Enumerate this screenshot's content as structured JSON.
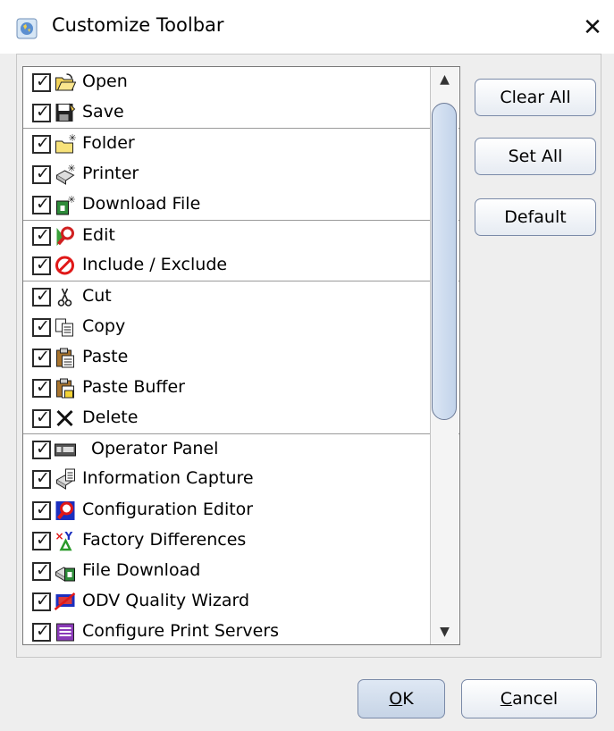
{
  "window": {
    "title": "Customize Toolbar",
    "close_glyph": "✕",
    "app_icon": "app-globe-icon"
  },
  "toolbar_items": [
    {
      "label": "Open",
      "icon": "open-folder-icon",
      "checked": true,
      "group_start": false
    },
    {
      "label": "Save",
      "icon": "save-disk-icon",
      "checked": true,
      "group_start": false
    },
    {
      "label": "Folder",
      "icon": "new-folder-icon",
      "checked": true,
      "group_start": true
    },
    {
      "label": "Printer",
      "icon": "new-printer-icon",
      "checked": true,
      "group_start": false
    },
    {
      "label": "Download File",
      "icon": "download-file-icon",
      "checked": true,
      "group_start": false
    },
    {
      "label": "Edit",
      "icon": "edit-magnifier-icon",
      "checked": true,
      "group_start": true
    },
    {
      "label": "Include / Exclude",
      "icon": "prohibited-icon",
      "checked": true,
      "group_start": false
    },
    {
      "label": "Cut",
      "icon": "scissors-icon",
      "checked": true,
      "group_start": true
    },
    {
      "label": "Copy",
      "icon": "copy-icon",
      "checked": true,
      "group_start": false
    },
    {
      "label": "Paste",
      "icon": "paste-icon",
      "checked": true,
      "group_start": false
    },
    {
      "label": "Paste Buffer",
      "icon": "paste-buffer-icon",
      "checked": true,
      "group_start": false
    },
    {
      "label": "Delete",
      "icon": "delete-x-icon",
      "checked": true,
      "group_start": false
    },
    {
      "label": "Operator Panel",
      "icon": "operator-panel-icon",
      "checked": true,
      "group_start": true
    },
    {
      "label": "Information Capture",
      "icon": "information-capture-icon",
      "checked": true,
      "group_start": false
    },
    {
      "label": "Configuration Editor",
      "icon": "configuration-editor-icon",
      "checked": true,
      "group_start": false
    },
    {
      "label": "Factory Differences",
      "icon": "factory-differences-icon",
      "checked": true,
      "group_start": false
    },
    {
      "label": "File Download",
      "icon": "file-download-icon",
      "checked": true,
      "group_start": false
    },
    {
      "label": "ODV Quality Wizard",
      "icon": "odv-quality-wizard-icon",
      "checked": true,
      "group_start": false
    },
    {
      "label": "Configure Print Servers",
      "icon": "configure-print-servers-icon",
      "checked": true,
      "group_start": false
    }
  ],
  "side_buttons": {
    "clear_all": "Clear All",
    "set_all": "Set All",
    "default": "Default"
  },
  "footer": {
    "ok_mnemonic": "O",
    "ok_rest": "K",
    "cancel_mnemonic": "C",
    "cancel_rest": "ancel"
  },
  "check_glyph": "✓",
  "colors": {
    "dialog_bg": "#eeeeee",
    "list_bg": "#ffffff",
    "thumb": "#c8d7ec",
    "button_border": "#7a8aa8"
  }
}
